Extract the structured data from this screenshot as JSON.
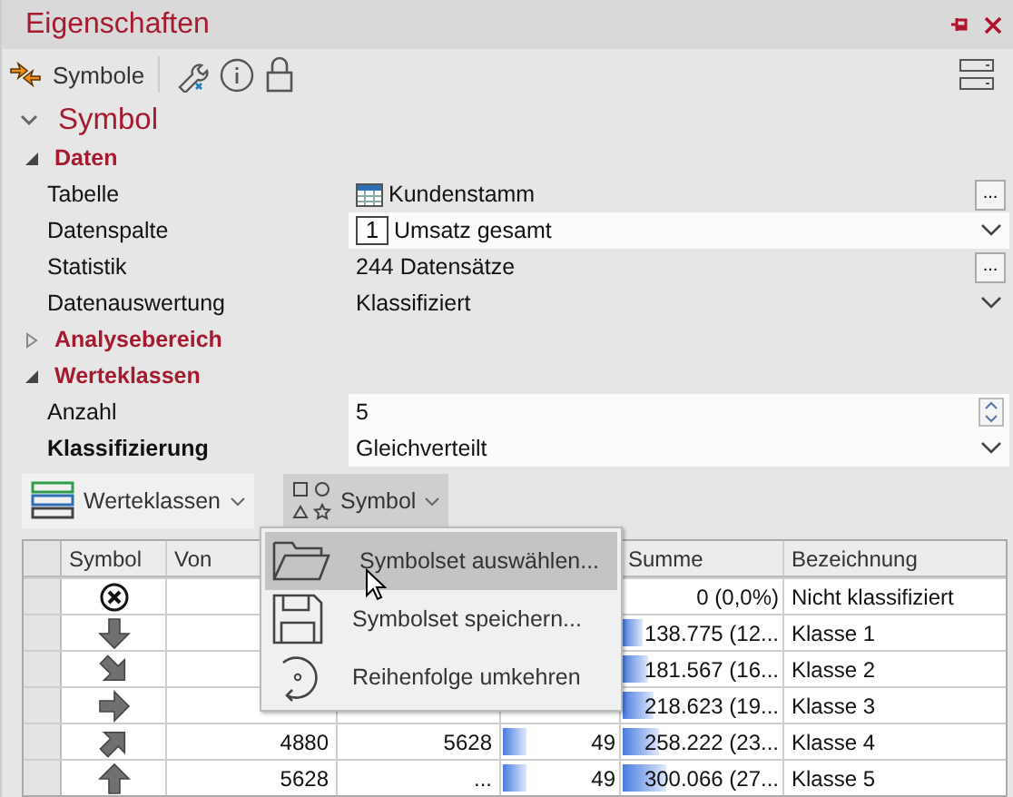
{
  "window": {
    "title": "Eigenschaften"
  },
  "toolbar": {
    "label": "Symbole"
  },
  "section": {
    "title": "Symbol",
    "expanded": true
  },
  "categories": [
    {
      "title": "Daten",
      "expanded": true,
      "properties": [
        {
          "label": "Tabelle",
          "value": "Kundenstamm",
          "kind": "ellipsis",
          "button": "...",
          "editable": false,
          "modified": false
        },
        {
          "label": "Datenspalte",
          "value": "Umsatz gesamt",
          "badge": "1",
          "kind": "dropdown",
          "editable": true,
          "modified": false
        },
        {
          "label": "Statistik",
          "value": "244 Datensätze",
          "kind": "ellipsis",
          "button": "...",
          "editable": false,
          "modified": false
        },
        {
          "label": "Datenauswertung",
          "value": "Klassifiziert",
          "kind": "dropdown",
          "editable": false,
          "modified": false
        }
      ]
    },
    {
      "title": "Analysebereich",
      "expanded": false
    },
    {
      "title": "Werteklassen",
      "expanded": true,
      "properties": [
        {
          "label": "Anzahl",
          "value": "5",
          "kind": "spin",
          "editable": true,
          "modified": false
        },
        {
          "label": "Klassifizierung",
          "value": "Gleichverteilt",
          "kind": "dropdown",
          "editable": true,
          "modified": true
        }
      ]
    }
  ],
  "buttons": [
    {
      "label": "Werteklassen",
      "kind": "classes",
      "open": false
    },
    {
      "label": "Symbol",
      "kind": "shapes",
      "open": true
    }
  ],
  "menu": {
    "items": [
      {
        "label": "Symbolset auswählen...",
        "selected": true
      },
      {
        "label": "Symbolset speichern...",
        "selected": false
      },
      {
        "label": "Reihenfolge umkehren",
        "selected": false
      }
    ]
  },
  "table": {
    "columns": [
      "Symbol",
      "Von",
      "Summe",
      "Bezeichnung"
    ],
    "rows": [
      {
        "kind": "none",
        "sum": {
          "text": "0 (0,0%)"
        },
        "name": "Nicht klassifiziert"
      },
      {
        "kind": "down",
        "sum": {
          "text": "138.775 (12...",
          "level": 0.12
        },
        "name": "Klasse 1"
      },
      {
        "kind": "down-right",
        "sum": {
          "text": "181.567 (16...",
          "level": 0.16
        },
        "name": "Klasse 2"
      },
      {
        "kind": "right",
        "sum": {
          "text": "218.623 (19...",
          "level": 0.19
        },
        "name": "Klasse 3"
      },
      {
        "kind": "up-right",
        "from": "4880",
        "to": "5628",
        "count": {
          "text": "49",
          "level": 0.2
        },
        "sum": {
          "text": "258.222 (23...",
          "level": 0.23
        },
        "name": "Klasse 4"
      },
      {
        "kind": "up",
        "from": "5628",
        "to": "...",
        "count": {
          "text": "49",
          "level": 0.2
        },
        "sum": {
          "text": "300.066 (27...",
          "level": 0.27
        },
        "name": "Klasse 5"
      }
    ]
  }
}
